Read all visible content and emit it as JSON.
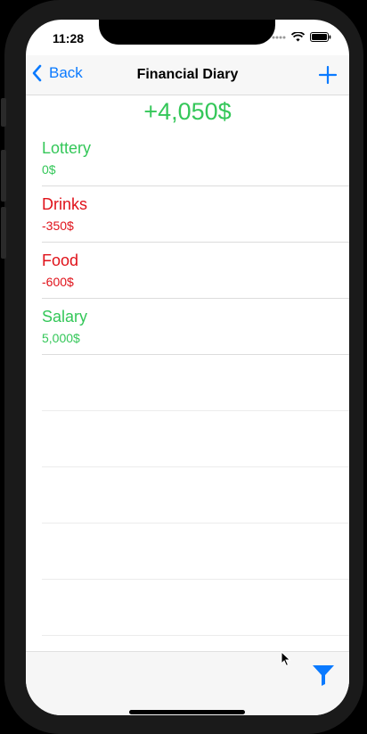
{
  "status_bar": {
    "time": "11:28"
  },
  "nav": {
    "back_label": "Back",
    "title": "Financial Diary"
  },
  "total": "+4,050$",
  "entries": [
    {
      "title": "Lottery",
      "amount": "0$",
      "type": "income"
    },
    {
      "title": "Drinks",
      "amount": "-350$",
      "type": "expense"
    },
    {
      "title": "Food",
      "amount": "-600$",
      "type": "expense"
    },
    {
      "title": "Salary",
      "amount": "5,000$",
      "type": "income"
    }
  ],
  "colors": {
    "income": "#34c759",
    "expense": "#e0121a",
    "accent": "#0a7aff"
  },
  "icons": [
    "chevron-left-icon",
    "plus-icon",
    "filter-icon",
    "wifi-icon",
    "battery-icon",
    "signal-icon"
  ]
}
